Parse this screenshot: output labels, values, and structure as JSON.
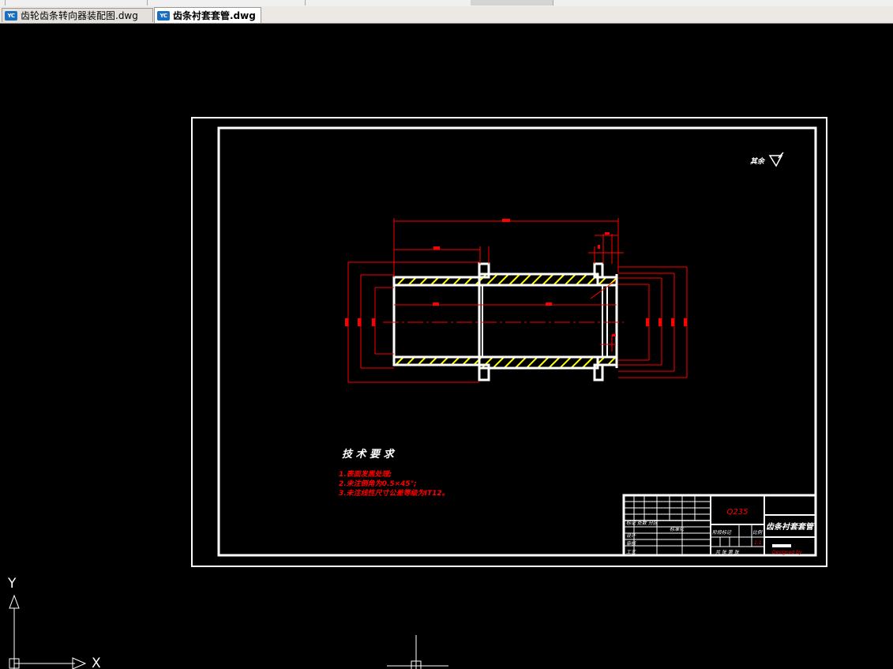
{
  "tabs": [
    {
      "label": "齿轮齿条转向器装配图.dwg",
      "icon": "dwg-file-icon",
      "active": false
    },
    {
      "label": "齿条衬套套管.dwg",
      "icon": "dwg-file-icon",
      "active": true
    }
  ],
  "drawing": {
    "surface_finish_label": "其余",
    "tech_req_title": "技 术 要 求",
    "tech_req_items": [
      "1.表面发黑处理;",
      "2.未注倒角为0.5×45°;",
      "3.未注线性尺寸公差等级为IT12。"
    ],
    "title_block": {
      "material": "Q235",
      "part_name": "齿条衬套套管",
      "revision_label": "标记 处数 分区",
      "stage_label": "阶段标记",
      "scale_label": "比例",
      "scale_value": "1:1",
      "design_label": "设计",
      "check_label": "审核",
      "standard_label": "标准化",
      "approve_label": "工艺",
      "sheet_label": "共 张 第 张",
      "drawing_no": "Designed by"
    }
  },
  "ucs": {
    "y_label": "Y",
    "x_label": "X"
  },
  "colors": {
    "background": "#000000",
    "outline": "#ffffff",
    "dimension": "#ff0000",
    "hatch": "#ffff00",
    "tab_icon": "#1a6fbf"
  }
}
